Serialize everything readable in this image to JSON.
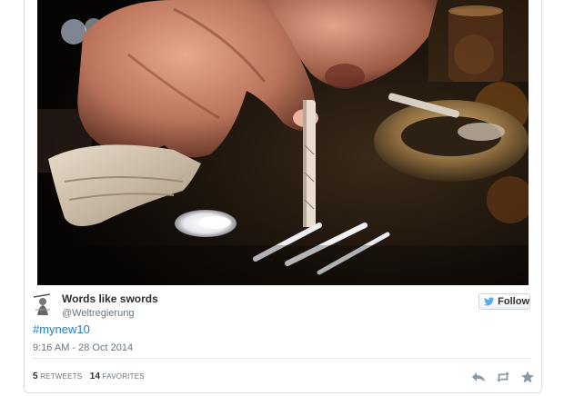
{
  "media": {
    "kind": "photo"
  },
  "author": {
    "display_name": "Words like swords",
    "screen_name": "@Weltregierung"
  },
  "follow_button": {
    "label": "Follow"
  },
  "tweet": {
    "hashtag": "#mynew10",
    "timestamp": "9:16 AM - 28 Oct 2014"
  },
  "stats": {
    "retweets_count": "5",
    "retweets_label": "RETWEETS",
    "favorites_count": "14",
    "favorites_label": "FAVORITES"
  },
  "actions": {
    "icons": [
      "reply-icon",
      "retweet-icon",
      "favorite-icon"
    ]
  },
  "colors": {
    "link": "#2b7bb9",
    "twitter_bird": "#55acee",
    "icon_gray": "#8899a6",
    "text_dark": "#292f33",
    "text_muted": "#66757f"
  }
}
